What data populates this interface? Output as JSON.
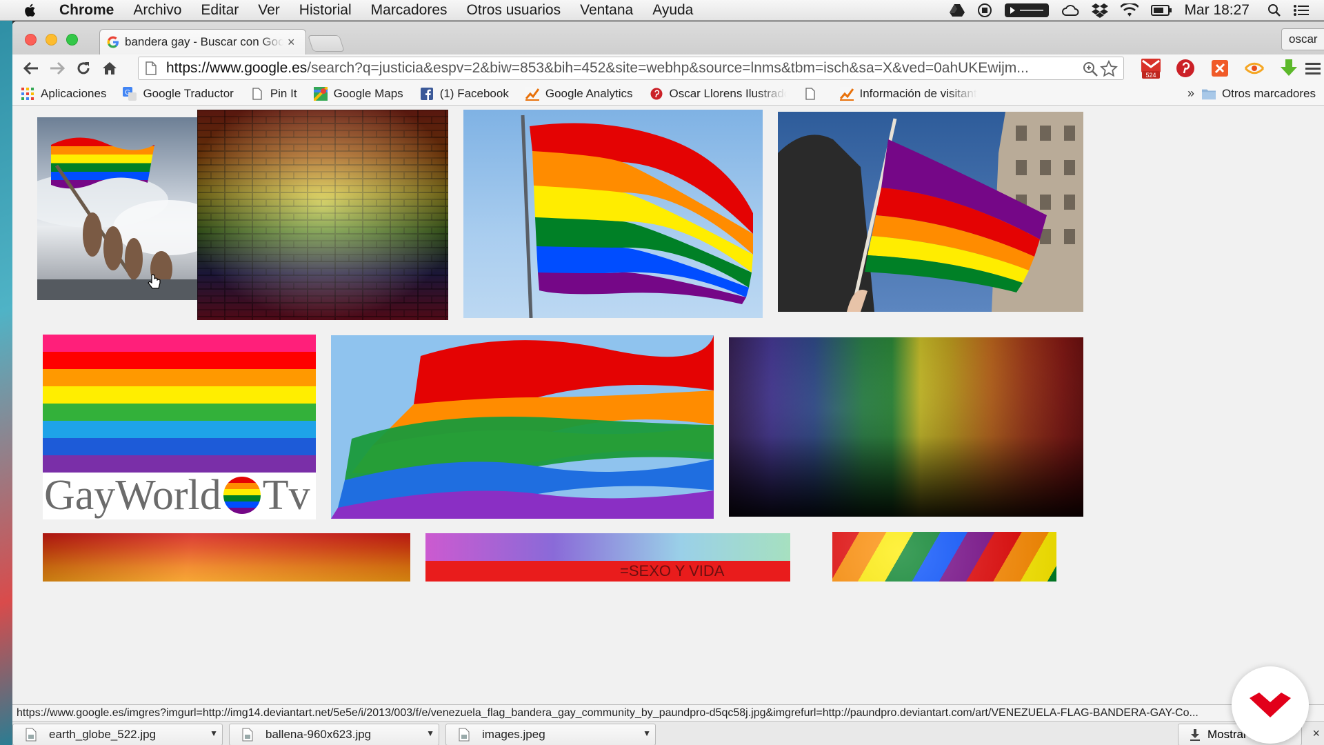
{
  "menubar": {
    "items": [
      "Chrome",
      "Archivo",
      "Editar",
      "Ver",
      "Historial",
      "Marcadores",
      "Otros usuarios",
      "Ventana",
      "Ayuda"
    ],
    "clock": "Mar 18:27",
    "status_icons": [
      "drive-icon",
      "record-icon",
      "media-icon",
      "cloud-icon",
      "dropbox-icon",
      "wifi-icon",
      "battery-icon",
      "search-icon",
      "list-icon"
    ]
  },
  "tab": {
    "title": "bandera gay - Buscar con Google",
    "close": "×"
  },
  "profile": {
    "label": "oscar"
  },
  "toolbar": {
    "url_domain": "https://www.google.es",
    "url_rest": "/search?q=justicia&espv=2&biw=853&bih=452&site=webhp&source=lnms&tbm=isch&sa=X&ved=0ahUKEwijm...",
    "gmail_badge": "524"
  },
  "bookmarks": {
    "items": [
      "Aplicaciones",
      "Google Traductor",
      "Pin It",
      "Google Maps",
      "(1) Facebook",
      "Google Analytics",
      "Oscar Llorens Ilustrador",
      "",
      "Información de visitantes"
    ],
    "more": "»",
    "other": "Otros marcadores"
  },
  "images": {
    "brand_caption": "GayWorld",
    "brand_caption_2": "Tv",
    "banner_caption": "=SEXO Y VIDA"
  },
  "status_url": "https://www.google.es/imgres?imgurl=http://img14.deviantart.net/5e5e/i/2013/003/f/e/venezuela_flag_bandera_gay_community_by_paundpro-d5qc58j.jpg&imgrefurl=http://paundpro.deviantart.com/art/VENEZUELA-FLAG-BANDERA-GAY-Co...",
  "downloads": {
    "files": [
      "earth_globe_522.jpg",
      "ballena-960x623.jpg",
      "images.jpeg"
    ],
    "show_all": "Mostrar todas",
    "close": "×"
  },
  "colors": {
    "rainbow": [
      "#e40303",
      "#ff8c00",
      "#ffed00",
      "#008026",
      "#004dff",
      "#750787"
    ],
    "gmail_red": "#d8322a",
    "logo_red": "#e2001a"
  }
}
